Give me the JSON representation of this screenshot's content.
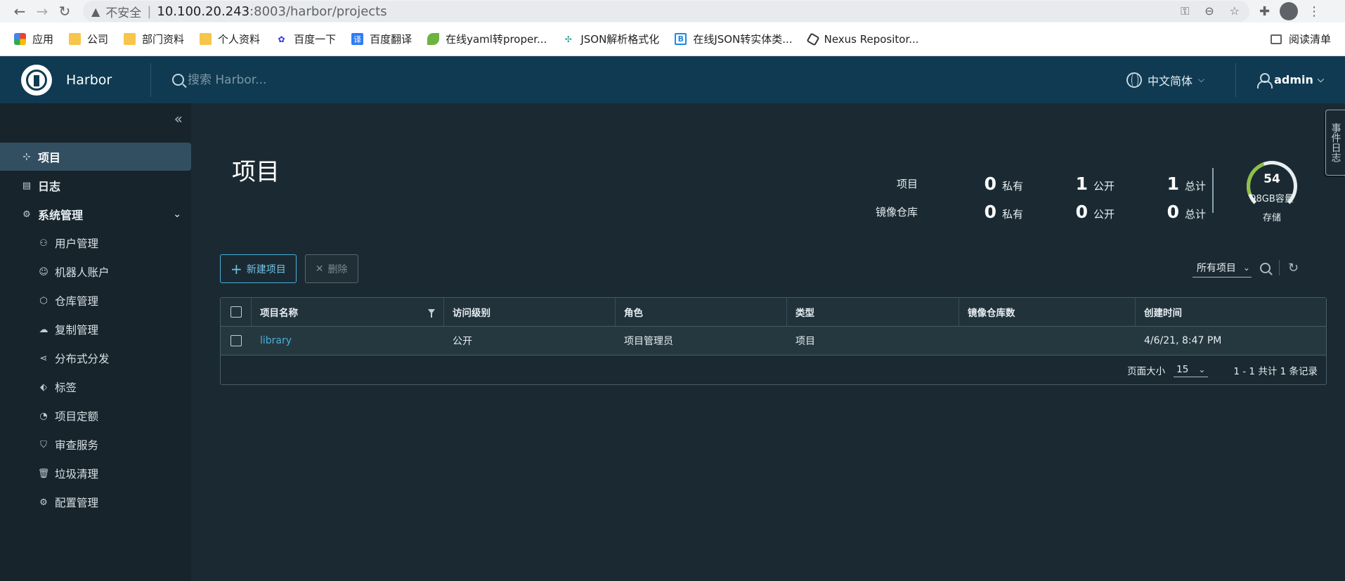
{
  "browser": {
    "insecure_label": "不安全",
    "url_host": "10.100.20.243",
    "url_port_path": ":8003/harbor/projects",
    "bookmarks": [
      {
        "icon": "apps-icon",
        "label": "应用"
      },
      {
        "icon": "folder-icon",
        "label": "公司"
      },
      {
        "icon": "folder-icon",
        "label": "部门资料"
      },
      {
        "icon": "folder-icon",
        "label": "个人资料"
      },
      {
        "icon": "baidu-icon",
        "label": "百度一下"
      },
      {
        "icon": "fanyi-icon",
        "label": "百度翻译"
      },
      {
        "icon": "leaf-icon",
        "label": "在线yaml转proper..."
      },
      {
        "icon": "json-icon",
        "label": "JSON解析格式化"
      },
      {
        "icon": "bj-icon",
        "label": "在线JSON转实体类..."
      },
      {
        "icon": "nexus-icon",
        "label": "Nexus Repositor..."
      }
    ],
    "reading_list": "阅读清单"
  },
  "header": {
    "brand": "Harbor",
    "search_placeholder": "搜索 Harbor...",
    "language": "中文简体",
    "user": "admin"
  },
  "sidebar": {
    "items": [
      {
        "label": "项目",
        "icon": "projects-icon",
        "active": true
      },
      {
        "label": "日志",
        "icon": "logs-icon"
      },
      {
        "label": "系统管理",
        "icon": "admin-icon",
        "expanded": true
      },
      {
        "label": "用户管理",
        "icon": "users-icon",
        "sub": true
      },
      {
        "label": "机器人账户",
        "icon": "robot-icon",
        "sub": true
      },
      {
        "label": "仓库管理",
        "icon": "registry-icon",
        "sub": true
      },
      {
        "label": "复制管理",
        "icon": "replication-icon",
        "sub": true
      },
      {
        "label": "分布式分发",
        "icon": "distribution-icon",
        "sub": true
      },
      {
        "label": "标签",
        "icon": "tag-icon",
        "sub": true
      },
      {
        "label": "项目定额",
        "icon": "quota-icon",
        "sub": true
      },
      {
        "label": "审查服务",
        "icon": "shield-icon",
        "sub": true
      },
      {
        "label": "垃圾清理",
        "icon": "trash-icon",
        "sub": true
      },
      {
        "label": "配置管理",
        "icon": "gear-icon",
        "sub": true
      }
    ]
  },
  "main": {
    "title": "项目",
    "stats": {
      "projects_label": "项目",
      "repos_label": "镜像仓库",
      "private_label": "私有",
      "public_label": "公开",
      "total_label": "总计",
      "projects_private": "0",
      "projects_public": "1",
      "projects_total": "1",
      "repos_private": "0",
      "repos_public": "0",
      "repos_total": "0"
    },
    "storage": {
      "value": "54",
      "capacity": "98GB容量",
      "label": "存储"
    },
    "side_tab": "事件日志",
    "toolbar": {
      "new_project": "新建项目",
      "delete": "删除"
    },
    "filter": {
      "selected": "所有项目"
    },
    "table": {
      "headers": [
        "项目名称",
        "访问级别",
        "角色",
        "类型",
        "镜像仓库数",
        "创建时间"
      ],
      "rows": [
        {
          "name": "library",
          "access": "公开",
          "role": "项目管理员",
          "type": "项目",
          "repo_count": "",
          "created": "4/6/21, 8:47 PM"
        }
      ],
      "footer": {
        "page_size_label": "页面大小",
        "page_size": "15",
        "summary": "1 - 1 共计 1 条记录"
      }
    }
  }
}
